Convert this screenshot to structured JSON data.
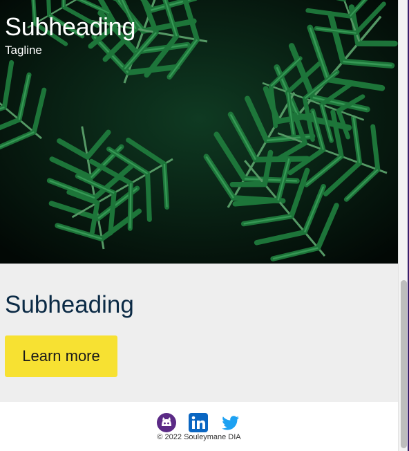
{
  "hero": {
    "title": "Subheading",
    "tagline": "Tagline",
    "image": "tropical-palm-leaves-photo"
  },
  "cta": {
    "title": "Subheading",
    "button_label": "Learn more",
    "button_color": "#f7e132"
  },
  "footer": {
    "socials": [
      {
        "name": "github-icon",
        "color": "#5b2a86"
      },
      {
        "name": "linkedin-icon",
        "color": "#0a66c2"
      },
      {
        "name": "twitter-icon",
        "color": "#1da1f2"
      }
    ],
    "copyright": "© 2022 Souleymane DIA"
  },
  "colors": {
    "heading": "#0b2a45",
    "section_bg": "#eeeeee"
  }
}
